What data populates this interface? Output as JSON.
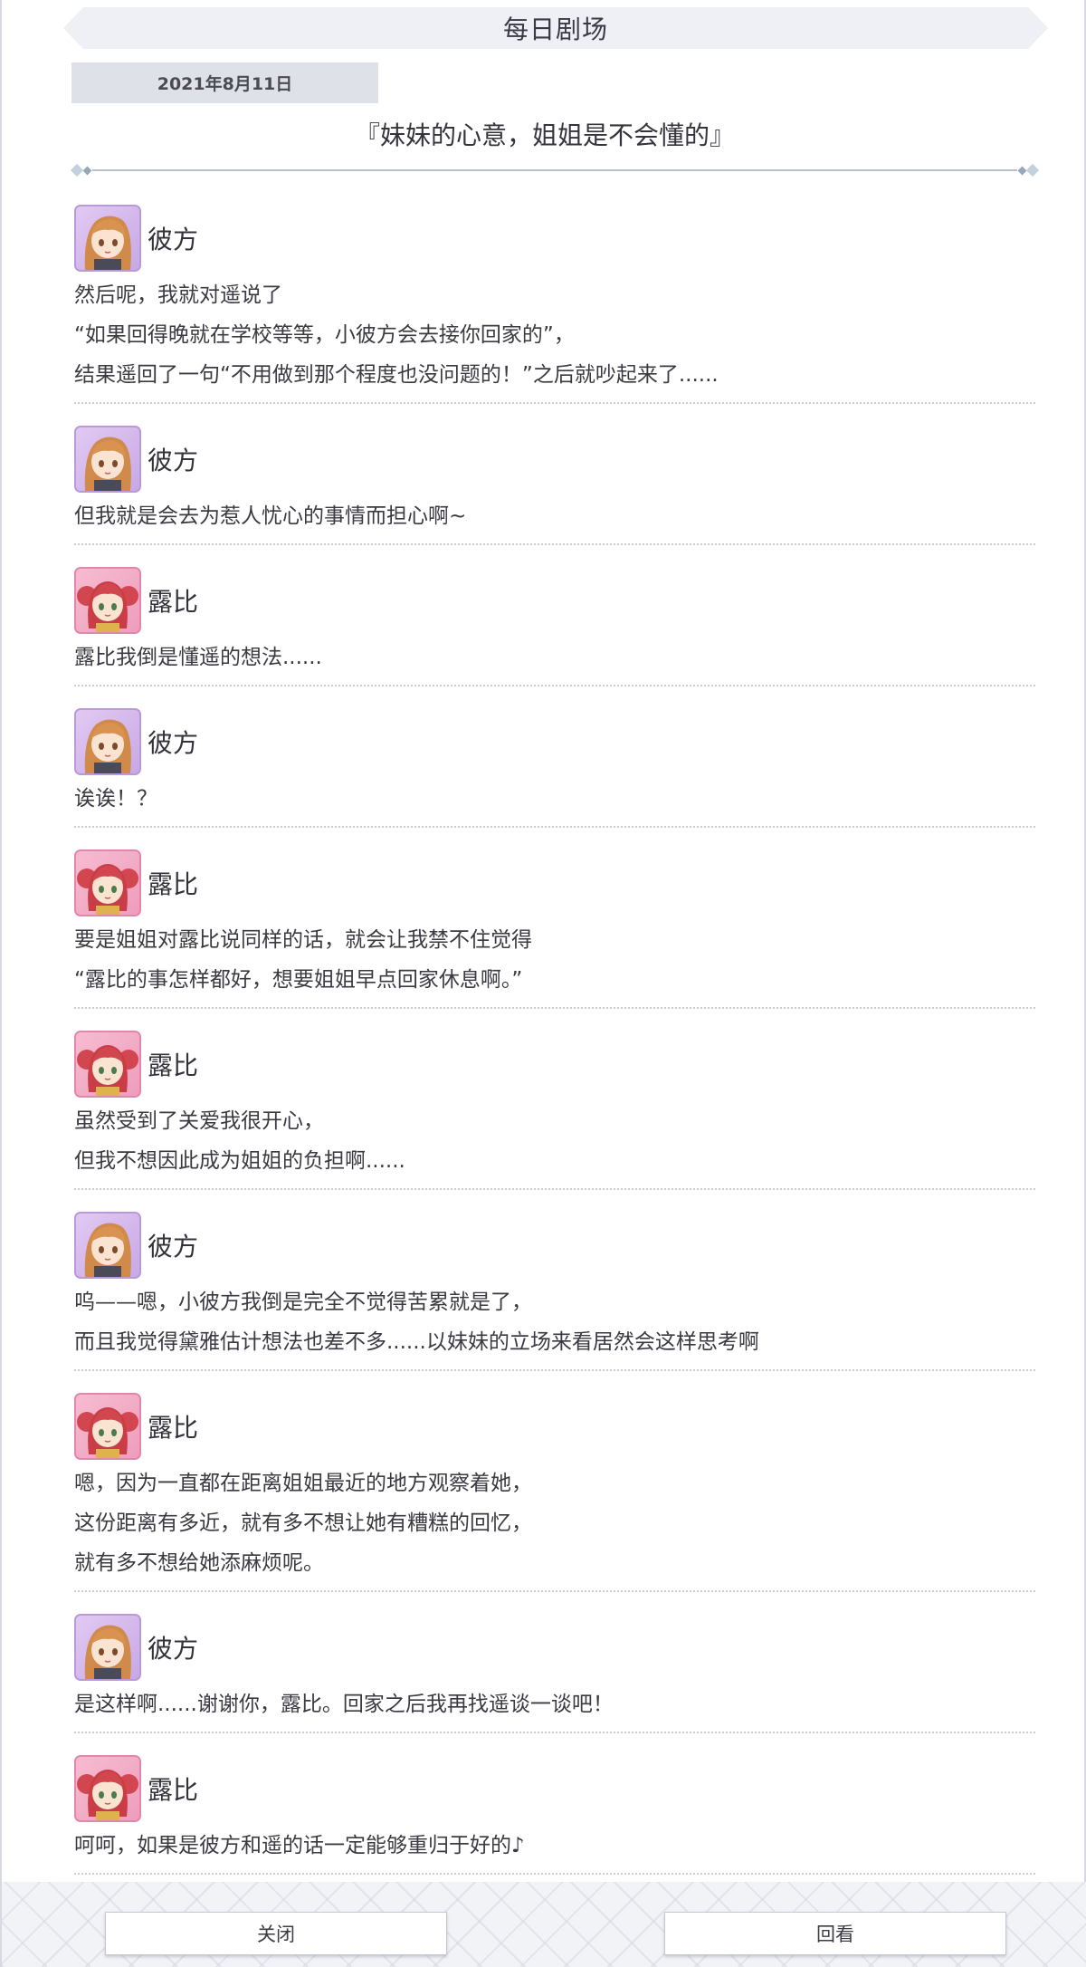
{
  "header": {
    "title": "每日剧场"
  },
  "episode": {
    "date": "2021年8月11日",
    "title": "『妹妹的心意，姐姐是不会懂的』"
  },
  "messages": [
    {
      "speaker": "彼方",
      "avatar": "kanata-avatar",
      "lines": [
        "然后呢，我就对遥说了",
        "“如果回得晚就在学校等等，小彼方会去接你回家的”，",
        "结果遥回了一句“不用做到那个程度也没问题的！”之后就吵起来了......"
      ]
    },
    {
      "speaker": "彼方",
      "avatar": "kanata-avatar",
      "lines": [
        "但我就是会去为惹人忧心的事情而担心啊~"
      ]
    },
    {
      "speaker": "露比",
      "avatar": "ruby-avatar",
      "lines": [
        "露比我倒是懂遥的想法......"
      ]
    },
    {
      "speaker": "彼方",
      "avatar": "kanata-avatar",
      "lines": [
        "诶诶！？"
      ]
    },
    {
      "speaker": "露比",
      "avatar": "ruby-avatar",
      "lines": [
        "要是姐姐对露比说同样的话，就会让我禁不住觉得",
        "“露比的事怎样都好，想要姐姐早点回家休息啊。”"
      ]
    },
    {
      "speaker": "露比",
      "avatar": "ruby-avatar",
      "lines": [
        "虽然受到了关爱我很开心，",
        "但我不想因此成为姐姐的负担啊......"
      ]
    },
    {
      "speaker": "彼方",
      "avatar": "kanata-avatar",
      "lines": [
        "呜——嗯，小彼方我倒是完全不觉得苦累就是了，",
        "而且我觉得黛雅估计想法也差不多......以妹妹的立场来看居然会这样思考啊"
      ]
    },
    {
      "speaker": "露比",
      "avatar": "ruby-avatar",
      "lines": [
        "嗯，因为一直都在距离姐姐最近的地方观察着她，",
        "这份距离有多近，就有多不想让她有糟糕的回忆，",
        "就有多不想给她添麻烦呢。"
      ]
    },
    {
      "speaker": "彼方",
      "avatar": "kanata-avatar",
      "lines": [
        "是这样啊......谢谢你，露比。回家之后我再找遥谈一谈吧！"
      ]
    },
    {
      "speaker": "露比",
      "avatar": "ruby-avatar",
      "lines": [
        "呵呵，如果是彼方和遥的话一定能够重归于好的♪"
      ]
    }
  ],
  "footer": {
    "close_label": "关闭",
    "replay_label": "回看"
  },
  "colors": {
    "kanata_frame": "#c7a9e6",
    "ruby_frame": "#ee9dbd",
    "divider": "#c9ccd4"
  }
}
